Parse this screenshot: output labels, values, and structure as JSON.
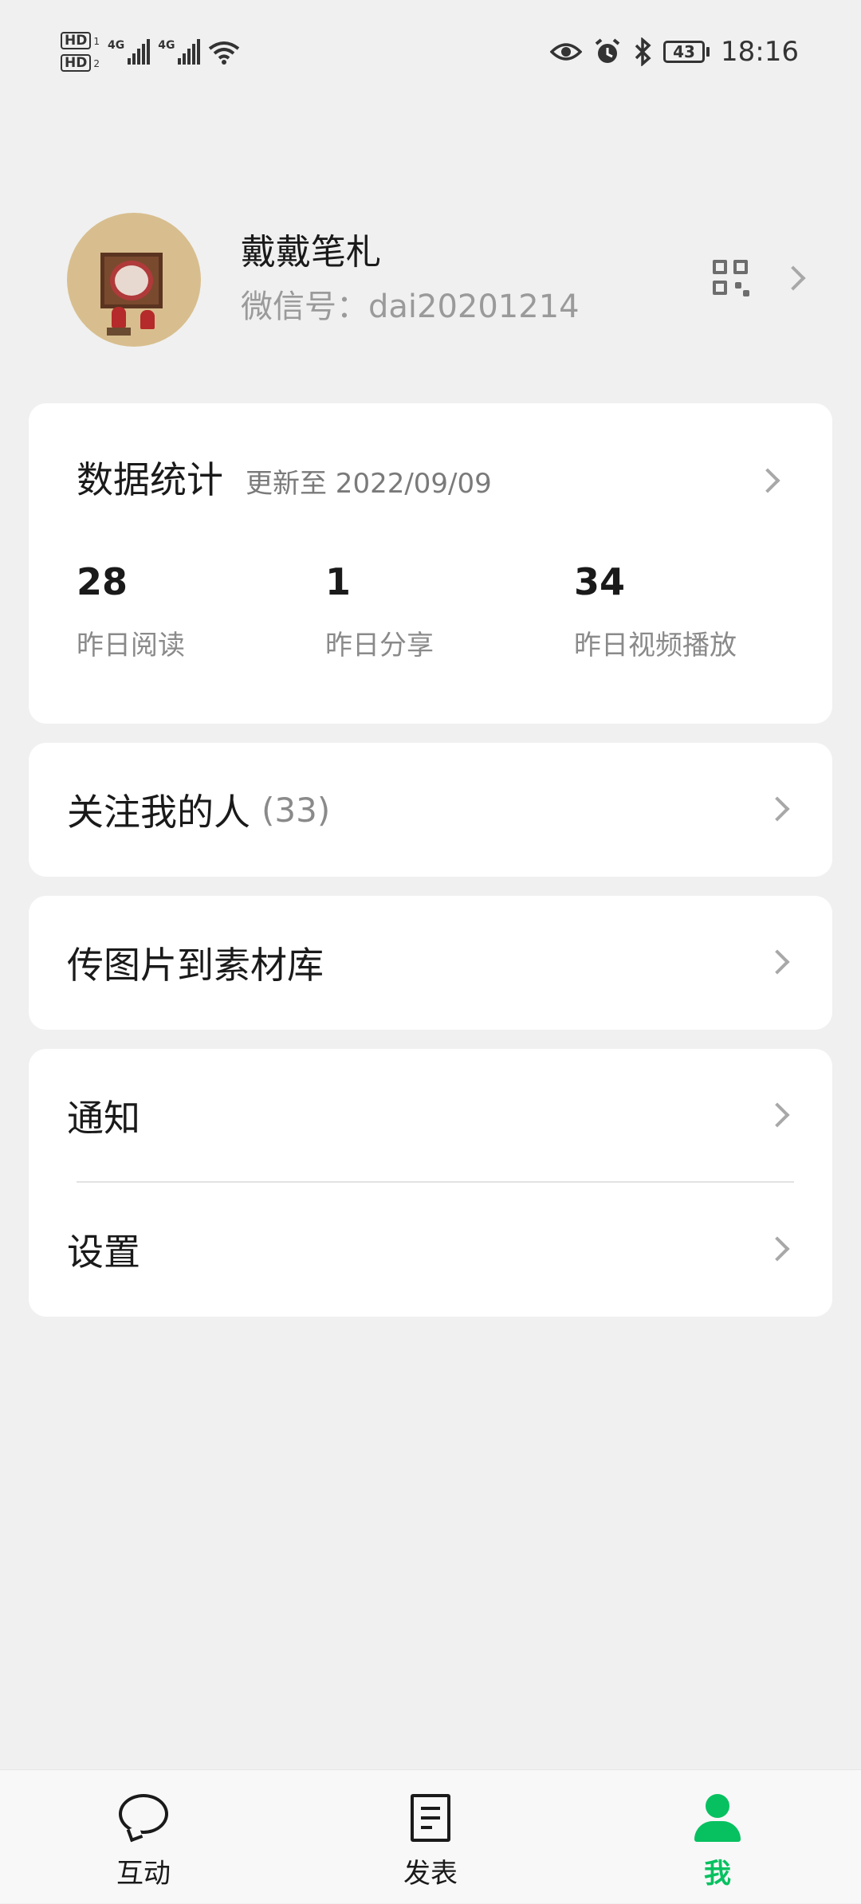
{
  "status_bar": {
    "hd1": "HD",
    "hd1_num": "1",
    "hd2": "HD",
    "hd2_num": "2",
    "sim1_type": "4G",
    "sim2_type": "4G",
    "battery": "43",
    "time": "18:16",
    "icons": [
      "eye-icon",
      "alarm-icon",
      "bluetooth-icon",
      "wifi-icon",
      "signal-icon"
    ]
  },
  "profile": {
    "name": "戴戴笔札",
    "wechat_id": "微信号：dai20201214"
  },
  "stats": {
    "title": "数据统计",
    "updated": "更新至 2022/09/09",
    "items": [
      {
        "value": "28",
        "label": "昨日阅读"
      },
      {
        "value": "1",
        "label": "昨日分享"
      },
      {
        "value": "34",
        "label": "昨日视频播放"
      }
    ]
  },
  "followers": {
    "label": "关注我的人",
    "count": "(33)"
  },
  "upload": {
    "label": "传图片到素材库"
  },
  "settings_card": {
    "notify_label": "通知",
    "settings_label": "设置"
  },
  "tabbar": {
    "tabs": [
      {
        "label": "互动",
        "icon": "chat-bubble-icon"
      },
      {
        "label": "发表",
        "icon": "document-icon"
      },
      {
        "label": "我",
        "icon": "person-icon",
        "active": true
      }
    ],
    "active_color": "#07C160"
  }
}
